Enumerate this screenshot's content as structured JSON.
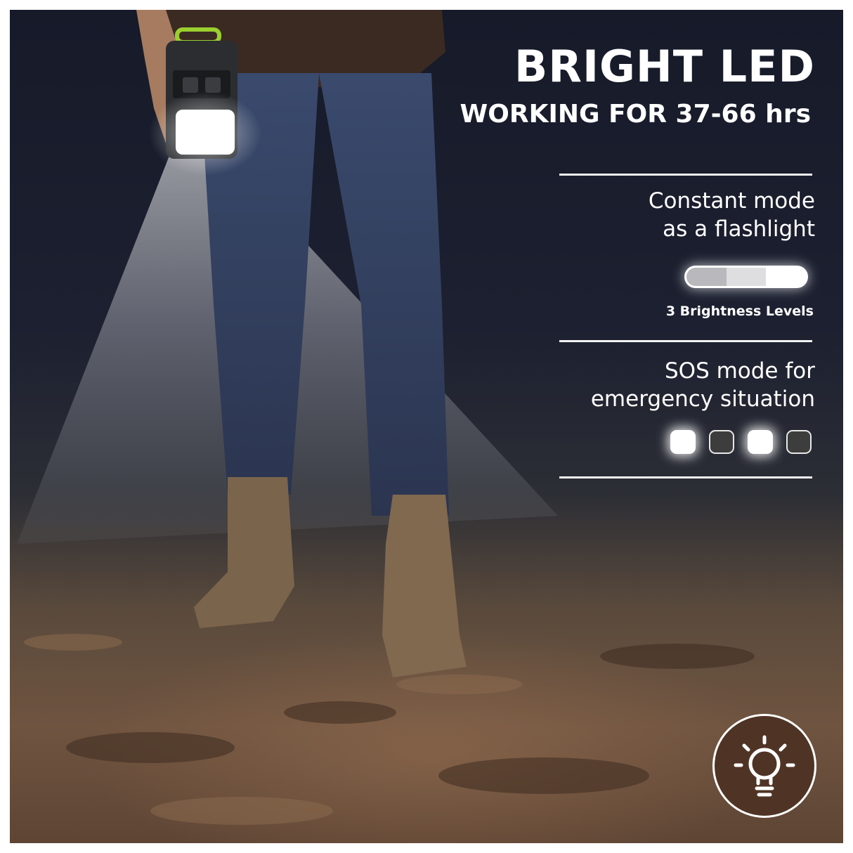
{
  "headline": "BRIGHT LED",
  "subheadline": "WORKING FOR 37-66 hrs",
  "constant_mode": {
    "title_line1": "Constant mode",
    "title_line2": "as a flashlight",
    "caption": "3 Brightness Levels",
    "levels": [
      {
        "color": "#b9b9bd"
      },
      {
        "color": "#dedee0"
      },
      {
        "color": "#ffffff"
      }
    ]
  },
  "sos_mode": {
    "title_line1": "SOS mode for",
    "title_line2": "emergency situation",
    "lights": [
      {
        "state": "on"
      },
      {
        "state": "off"
      },
      {
        "state": "on"
      },
      {
        "state": "off"
      }
    ]
  },
  "badge": {
    "icon": "lightbulb-icon",
    "background": "#4f3425"
  }
}
